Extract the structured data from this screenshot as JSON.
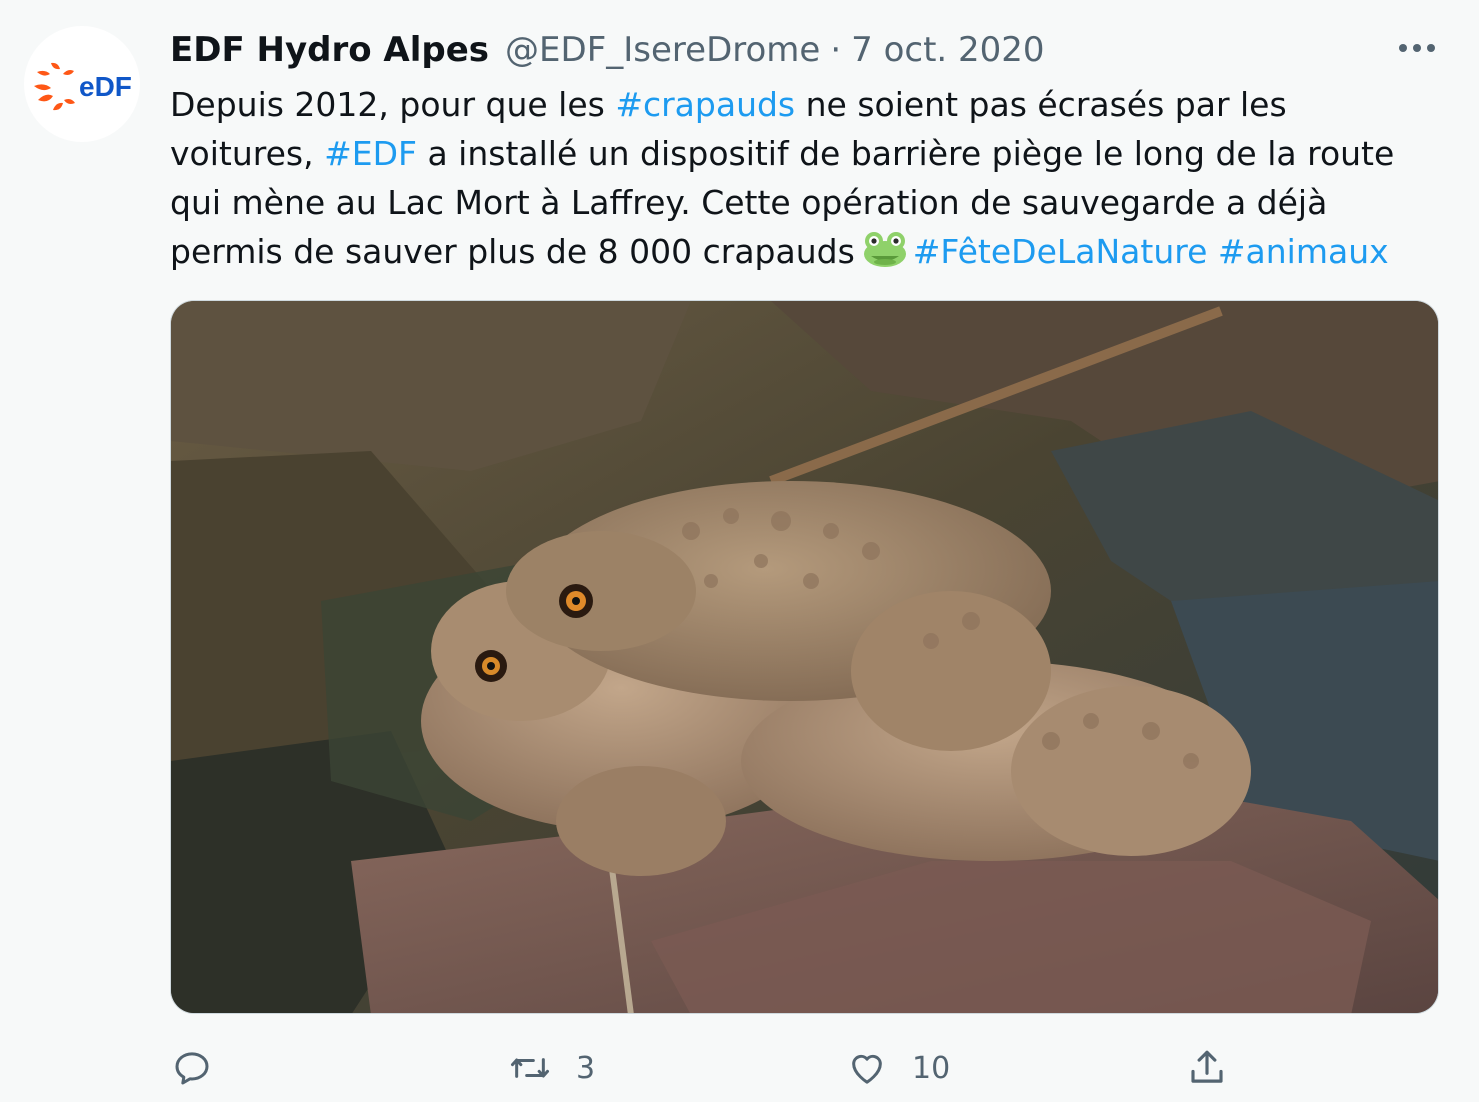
{
  "author": {
    "display_name": "EDF Hydro Alpes",
    "handle": "@EDF_IsereDrome",
    "separator": "·",
    "date": "7 oct. 2020",
    "avatar_logo_text": "eDF",
    "brand_colors": {
      "orange": "#fe5716",
      "blue": "#1057c8"
    }
  },
  "tweet": {
    "lines": [
      [
        {
          "text": "Depuis 2012, pour que les "
        },
        {
          "text": "#crapauds",
          "tag": true
        },
        {
          "text": " ne soient pas écrasés par les"
        }
      ],
      [
        {
          "text": "voitures, "
        },
        {
          "text": "#EDF",
          "tag": true
        },
        {
          "text": " a installé un dispositif de barrière piège le long de la route"
        }
      ],
      [
        {
          "text": "qui mène au Lac Mort à Laffrey. Cette opération de sauvegarde a déjà"
        }
      ],
      [
        {
          "text": "permis de sauver plus de 8 000 crapauds"
        },
        {
          "emoji": "frog-face"
        },
        {
          "text": "#FêteDeLaNature",
          "tag": true
        },
        {
          "text": " "
        },
        {
          "text": "#animaux",
          "tag": true
        }
      ]
    ],
    "hashtag_color": "#1d9bf0"
  },
  "media": {
    "icon": "photo-of-two-toads-on-rocks"
  },
  "actions": {
    "reply": {
      "icon": "reply-icon"
    },
    "retweet": {
      "icon": "retweet-icon",
      "count": "3"
    },
    "like": {
      "icon": "heart-icon",
      "count": "10"
    },
    "share": {
      "icon": "share-icon"
    }
  },
  "more_menu": {
    "icon": "more-dots-icon"
  }
}
